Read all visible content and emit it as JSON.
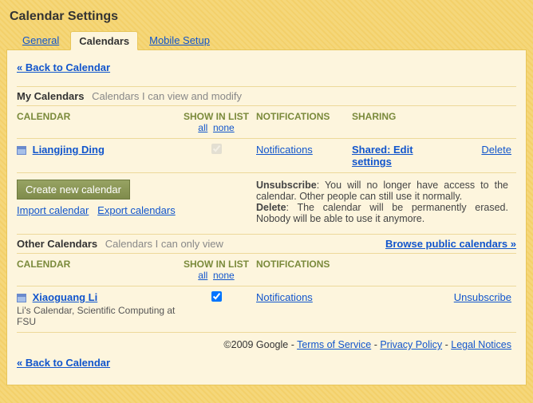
{
  "title": "Calendar Settings",
  "tabs": {
    "general": "General",
    "calendars": "Calendars",
    "mobile": "Mobile Setup"
  },
  "back": "« Back to Calendar",
  "my": {
    "title": "My Calendars",
    "sub": "Calendars I can view and modify",
    "headers": {
      "calendar": "CALENDAR",
      "show": "SHOW IN LIST",
      "notif": "NOTIFICATIONS",
      "sharing": "SHARING"
    },
    "all": "all",
    "none": "none",
    "row": {
      "name": "Liangjing Ding",
      "notif": "Notifications",
      "share": "Shared: Edit settings",
      "delete": "Delete"
    }
  },
  "actions": {
    "create": "Create new calendar",
    "import": "Import calendar",
    "export": "Export calendars",
    "help": {
      "unsub_label": "Unsubscribe",
      "unsub_text": ": You will no longer have access to the calendar. Other people can still use it normally.",
      "del_label": "Delete",
      "del_text": ": The calendar will be permanently erased. Nobody will be able to use it anymore."
    }
  },
  "other": {
    "title": "Other Calendars",
    "sub": "Calendars I can only view",
    "browse": "Browse public calendars »",
    "headers": {
      "calendar": "CALENDAR",
      "show": "SHOW IN LIST",
      "notif": "NOTIFICATIONS"
    },
    "all": "all",
    "none": "none",
    "row": {
      "name": "Xiaoguang Li",
      "desc": "Li's Calendar, Scientific Computing at FSU",
      "notif": "Notifications",
      "unsub": "Unsubscribe"
    }
  },
  "footer": {
    "copyright": "©2009 Google - ",
    "tos": "Terms of Service",
    "sep": " - ",
    "privacy": "Privacy Policy",
    "legal": "Legal Notices"
  }
}
